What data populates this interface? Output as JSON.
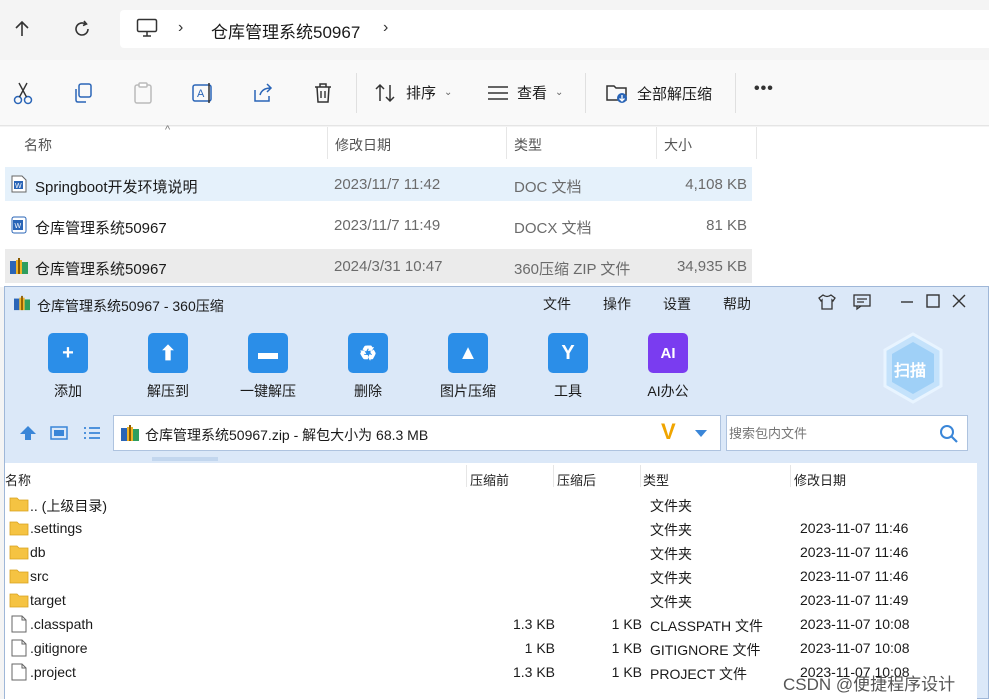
{
  "explorer": {
    "address": {
      "crumb": "仓库管理系统50967"
    },
    "toolbar": {
      "sort_label": "排序",
      "view_label": "查看",
      "extract_all_label": "全部解压缩",
      "more_label": "•••"
    },
    "columns": [
      "名称",
      "修改日期",
      "类型",
      "大小"
    ],
    "files": [
      {
        "name": "Springboot开发环境说明",
        "date": "2023/11/7 11:42",
        "type": "DOC 文档",
        "size": "4,108 KB",
        "icon": "word-doc-icon"
      },
      {
        "name": "仓库管理系统50967",
        "date": "2023/11/7 11:49",
        "type": "DOCX 文档",
        "size": "81 KB",
        "icon": "word-docx-icon"
      },
      {
        "name": "仓库管理系统50967",
        "date": "2024/3/31 10:47",
        "type": "360压缩 ZIP 文件",
        "size": "34,935 KB",
        "icon": "zip-archive-icon"
      }
    ]
  },
  "zip_window": {
    "title": "仓库管理系统50967 - 360压缩",
    "menu": [
      "文件",
      "操作",
      "设置",
      "帮助"
    ],
    "tools": [
      {
        "label": "添加",
        "icon": "add-icon",
        "color": "#2b8ee8"
      },
      {
        "label": "解压到",
        "icon": "extract-to-icon",
        "color": "#2b8ee8"
      },
      {
        "label": "一键解压",
        "icon": "one-click-extract-icon",
        "color": "#2b8ee8"
      },
      {
        "label": "删除",
        "icon": "delete-icon",
        "color": "#2b8ee8"
      },
      {
        "label": "图片压缩",
        "icon": "image-compress-icon",
        "color": "#2b8ee8"
      },
      {
        "label": "工具",
        "icon": "tools-icon",
        "color": "#2b8ee8"
      },
      {
        "label": "AI办公",
        "icon": "ai-office-icon",
        "color": "#7a3cf0"
      }
    ],
    "scan_label": "扫描",
    "path_text": "仓库管理系统50967.zip - 解包大小为 68.3 MB",
    "search_placeholder": "搜索包内文件",
    "columns": [
      "名称",
      "压缩前",
      "压缩后",
      "类型",
      "修改日期"
    ],
    "rows": [
      {
        "name": ".. (上级目录)",
        "before": "",
        "after": "",
        "type": "文件夹",
        "date": "",
        "kind": "folder"
      },
      {
        "name": ".settings",
        "before": "",
        "after": "",
        "type": "文件夹",
        "date": "2023-11-07 11:46",
        "kind": "folder"
      },
      {
        "name": "db",
        "before": "",
        "after": "",
        "type": "文件夹",
        "date": "2023-11-07 11:46",
        "kind": "folder"
      },
      {
        "name": "src",
        "before": "",
        "after": "",
        "type": "文件夹",
        "date": "2023-11-07 11:46",
        "kind": "folder"
      },
      {
        "name": "target",
        "before": "",
        "after": "",
        "type": "文件夹",
        "date": "2023-11-07 11:49",
        "kind": "folder"
      },
      {
        "name": ".classpath",
        "before": "1.3 KB",
        "after": "1 KB",
        "type": "CLASSPATH 文件",
        "date": "2023-11-07 10:08",
        "kind": "file"
      },
      {
        "name": ".gitignore",
        "before": "1 KB",
        "after": "1 KB",
        "type": "GITIGNORE 文件",
        "date": "2023-11-07 10:08",
        "kind": "file"
      },
      {
        "name": ".project",
        "before": "1.3 KB",
        "after": "1 KB",
        "type": "PROJECT 文件",
        "date": "2023-11-07 10:08",
        "kind": "file"
      }
    ]
  },
  "watermark": "CSDN @便捷程序设计",
  "colors": {
    "selected_row": "#e5f1fb",
    "hover_row": "#ebebeb",
    "zip_frame": "#dbe8f8",
    "accent": "#2b8ee8"
  }
}
